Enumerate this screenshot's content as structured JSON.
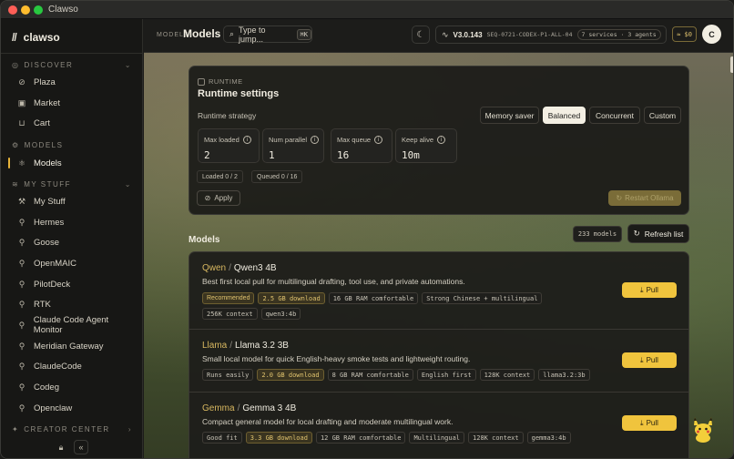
{
  "window": {
    "title": "Clawso"
  },
  "brand": {
    "logo": "//",
    "name": "clawso"
  },
  "sidebar": {
    "sections": [
      {
        "label": "DISCOVER"
      },
      {
        "label": "MODELS"
      },
      {
        "label": "MY STUFF"
      },
      {
        "label": "CREATOR CENTER"
      }
    ],
    "discover": [
      "Plaza",
      "Market",
      "Cart"
    ],
    "models": [
      "Models"
    ],
    "mystuff": [
      "My Stuff",
      "Hermes",
      "Goose",
      "OpenMAIC",
      "PilotDeck",
      "RTK",
      "Claude Code Agent Monitor",
      "Meridian Gateway",
      "ClaudeCode",
      "Codeg",
      "Openclaw"
    ]
  },
  "header": {
    "crumb_small": "MODELS",
    "crumb_title": "Models",
    "search_placeholder": "Type to jump...",
    "search_kbd": "⌘K",
    "version": "V3.0.143",
    "seq": "SEQ-0721-CODEX-P1-ALL-04",
    "services": "7 services · 3 agents",
    "cost": "≈ $0",
    "avatar": "C"
  },
  "runtime": {
    "tag": "RUNTIME",
    "title": "Runtime settings",
    "strategy_label": "Runtime strategy",
    "strategies": [
      "Memory saver",
      "Balanced",
      "Concurrent",
      "Custom"
    ],
    "selected_strategy": "Balanced",
    "fields": [
      {
        "label": "Max loaded",
        "value": "2"
      },
      {
        "label": "Num parallel",
        "value": "1"
      },
      {
        "label": "Max queue",
        "value": "16"
      },
      {
        "label": "Keep alive",
        "value": "10m"
      }
    ],
    "loaded": "Loaded 0 / 2",
    "queued": "Queued 0 / 16",
    "apply_label": "Apply",
    "restart_label": "Restart Ollama"
  },
  "models_section": {
    "title": "Models",
    "count": "233 models",
    "refresh_label": "Refresh list",
    "items": [
      {
        "family": "Qwen",
        "name": "Qwen3 4B",
        "desc": "Best first local pull for multilingual drafting, tool use, and private automations.",
        "tags": [
          "Recommended",
          "2.5 GB download",
          "16 GB RAM comfortable",
          "Strong Chinese + multilingual",
          "256K context",
          "qwen3:4b"
        ],
        "pull": "Pull"
      },
      {
        "family": "Llama",
        "name": "Llama 3.2 3B",
        "desc": "Small local model for quick English-heavy smoke tests and lightweight routing.",
        "tags": [
          "Runs easily",
          "2.0 GB download",
          "8 GB RAM comfortable",
          "English first",
          "128K context",
          "llama3.2:3b"
        ],
        "pull": "Pull"
      },
      {
        "family": "Gemma",
        "name": "Gemma 3 4B",
        "desc": "Compact general model for local drafting and moderate multilingual work.",
        "tags": [
          "Good fit",
          "3.3 GB download",
          "12 GB RAM comfortable",
          "Multilingual",
          "128K context",
          "gemma3:4b"
        ],
        "pull": "Pull"
      }
    ]
  },
  "colors": {
    "accent": "#f0c43d",
    "bg": "#1c1c1a",
    "active": "#e7b33a"
  }
}
